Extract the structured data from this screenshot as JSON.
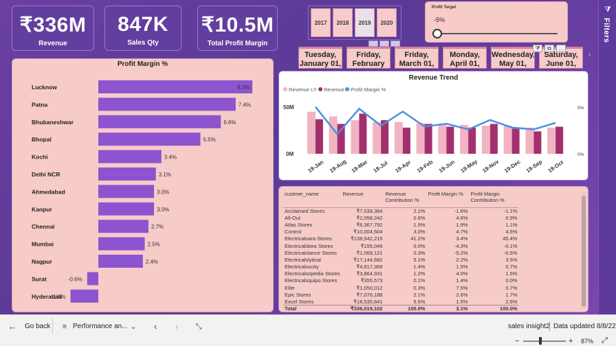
{
  "filters_pane": {
    "label": "Filters",
    "icon": "filter-icon"
  },
  "kpis": [
    {
      "value": "₹336M",
      "label": "Revenue"
    },
    {
      "value": "847K",
      "label": "Sales Qty"
    },
    {
      "value": "₹10.5M",
      "label": "Total Profit Margin"
    }
  ],
  "years": [
    "2017",
    "2018",
    "2019",
    "2020"
  ],
  "selected_year": "2019",
  "profit_target": {
    "title": "Profit Target",
    "value": "-5%",
    "level": 0.0
  },
  "dates": [
    {
      "line1": "Tuesday,",
      "line2": "January 01,"
    },
    {
      "line1": "Friday,",
      "line2": "February"
    },
    {
      "line1": "Friday,",
      "line2": "March 01,"
    },
    {
      "line1": "Monday,",
      "line2": "April 01,"
    },
    {
      "line1": "Wednesday,",
      "line2": "May 01,"
    },
    {
      "line1": "Saturday,",
      "line2": "June 01,"
    }
  ],
  "date_toolbar": [
    "⧩",
    "⧉",
    "…"
  ],
  "colors": {
    "bar_purple": "#8d54cf",
    "revenue_ly": "#f2b3c2",
    "revenue": "#a3306e",
    "profit_line": "#4a90e2"
  },
  "profit_margin_chart": {
    "title": "Profit Margin %",
    "chart_data": {
      "type": "bar",
      "orientation": "horizontal",
      "title": "Profit Margin %",
      "categories": [
        "Lucknow",
        "Patna",
        "Bhubaneshwar",
        "Bhopal",
        "Kochi",
        "Delhi NCR",
        "Ahmedabad",
        "Kanpur",
        "Chennai",
        "Mumbai",
        "Nagpur",
        "Surat",
        "Hyderabad"
      ],
      "values": [
        8.3,
        7.4,
        6.6,
        5.5,
        3.4,
        3.1,
        3.0,
        3.0,
        2.7,
        2.5,
        2.4,
        -0.6,
        -1.5
      ],
      "labels": [
        "8.3%",
        "7.4%",
        "6.6%",
        "5.5%",
        "3.4%",
        "3.1%",
        "3.0%",
        "3.0%",
        "2.7%",
        "2.5%",
        "2.4%",
        "-0.6%",
        "-1.5%"
      ]
    }
  },
  "revenue_trend": {
    "title": "Revenue Trend",
    "legend": [
      "Revenue LY",
      "Revenue",
      "Profit Margin %"
    ],
    "y_left_ticks": [
      "50M",
      "0M"
    ],
    "y_right_ticks": [
      "5%",
      "0%"
    ],
    "chart_data": {
      "type": "bar",
      "title": "Revenue Trend",
      "categories": [
        "19-Jan",
        "19-Aug",
        "19-Mar",
        "19-Jul",
        "19-Apr",
        "19-Feb",
        "19-Jun",
        "19-May",
        "19-Nov",
        "19-Dec",
        "19-Sep",
        "19-Oct"
      ],
      "x_tick_labels": [
        "19-Jan",
        "19-Aug",
        "19-Mar",
        "19-Jul",
        "19-Apr",
        "19-Feb",
        "19-Jun",
        "19-May",
        "19-Nov",
        "19-Dec",
        "19-Sep",
        "19-Oct"
      ],
      "series": [
        {
          "name": "Revenue LY",
          "type": "bar",
          "values": [
            45,
            40,
            36,
            34,
            34,
            33,
            32,
            31,
            30,
            30,
            28,
            28
          ]
        },
        {
          "name": "Revenue",
          "type": "bar",
          "values": [
            37,
            32,
            43,
            36,
            28,
            32,
            29,
            28,
            32,
            27,
            24,
            29
          ]
        },
        {
          "name": "Profit Margin %",
          "type": "line",
          "axis": "right",
          "values": [
            5.0,
            2.1,
            4.8,
            3.0,
            4.5,
            2.9,
            3.2,
            2.6,
            3.6,
            2.8,
            2.6,
            3.3
          ]
        }
      ],
      "ylim": [
        0,
        60
      ],
      "ylim_right": [
        0,
        6
      ]
    }
  },
  "table": {
    "headers": [
      "custmer_name",
      "Revenue",
      "Revenue Contribution %",
      "Profit Margin %",
      "Profit Margin Contribution %"
    ],
    "rows": [
      [
        "Acclaimed Stores",
        "₹7,039,364",
        "2.1%",
        "-1.6%",
        "-1.1%"
      ],
      [
        "All-Out",
        "₹2,058,242",
        "0.6%",
        "4.6%",
        "0.9%"
      ],
      [
        "Atlas Stores",
        "₹6,367,792",
        "1.9%",
        "1.9%",
        "1.1%"
      ],
      [
        "Control",
        "₹10,004,504",
        "3.0%",
        "4.7%",
        "4.5%"
      ],
      [
        "Electricalsara Stores",
        "₹138,542,215",
        "41.2%",
        "3.4%",
        "45.4%"
      ],
      [
        "Electricalsbea Stores",
        "₹155,049",
        "0.0%",
        "-4.3%",
        "-0.1%"
      ],
      [
        "Electricalslance Stores",
        "₹1,069,121",
        "0.3%",
        "-5.2%",
        "-0.5%"
      ],
      [
        "Electricalslytical",
        "₹17,144,682",
        "5.1%",
        "2.2%",
        "3.5%"
      ],
      [
        "Electricalsocity",
        "₹4,617,369",
        "1.4%",
        "1.5%",
        "0.7%"
      ],
      [
        "Electricalsopedia Stores",
        "₹3,864,931",
        "1.2%",
        "4.0%",
        "1.5%"
      ],
      [
        "Electricalsquipo Stores",
        "₹355,573",
        "0.1%",
        "1.4%",
        "0.0%"
      ],
      [
        "Elite",
        "₹1,050,012",
        "0.3%",
        "7.5%",
        "0.7%"
      ],
      [
        "Epic Stores",
        "₹7,076,188",
        "2.1%",
        "2.6%",
        "1.7%"
      ],
      [
        "Excel Stores",
        "₹18,535,841",
        "5.5%",
        "1.5%",
        "2.6%"
      ]
    ],
    "total": [
      "Total",
      "₹336,019,102",
      "100.0%",
      "3.1%",
      "100.0%"
    ]
  },
  "bottom_bar": {
    "back_label": "Go back",
    "page_label": "Performance an...",
    "report_name": "sales insight2",
    "updated": "Data updated 8/8/22",
    "zoom": "87%"
  }
}
